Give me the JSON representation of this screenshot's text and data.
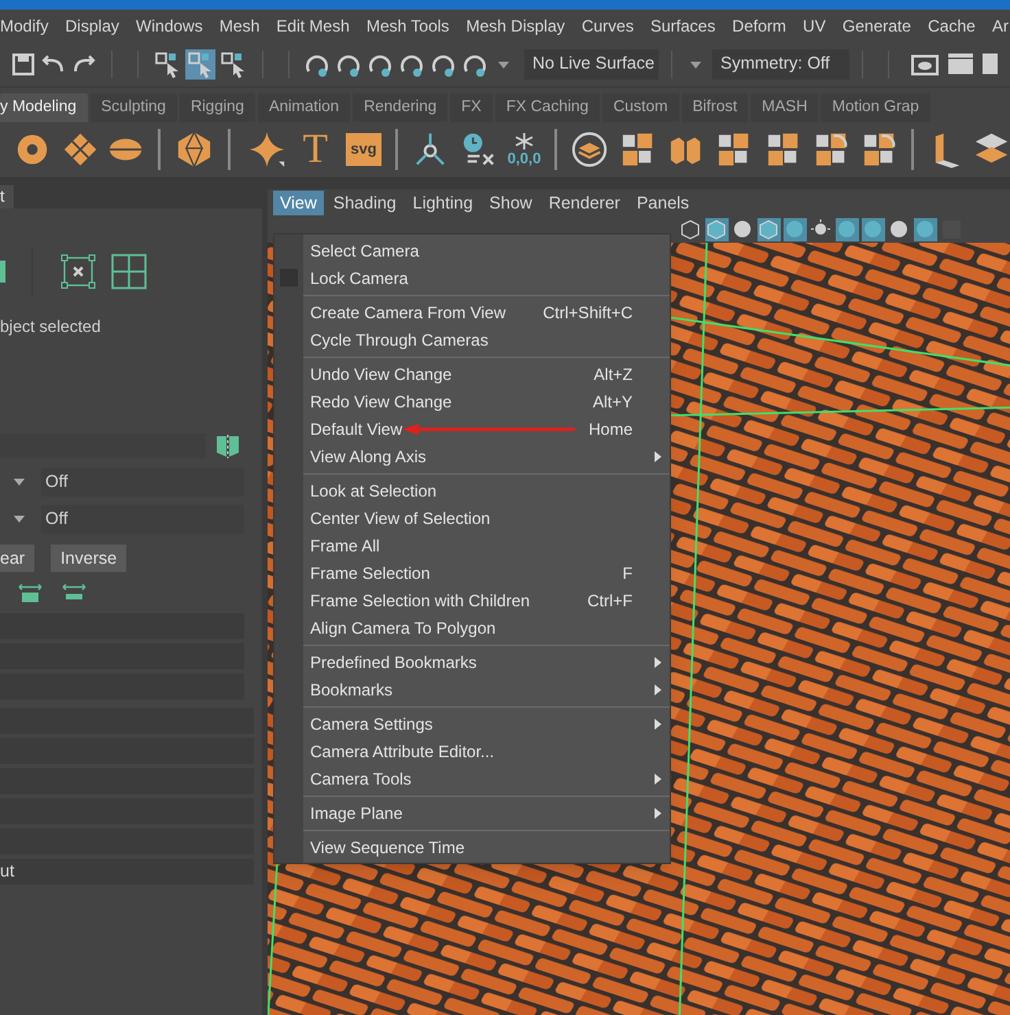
{
  "menu_bar": [
    "Modify",
    "Display",
    "Windows",
    "Mesh",
    "Edit Mesh",
    "Mesh Tools",
    "Mesh Display",
    "Curves",
    "Surfaces",
    "Deform",
    "UV",
    "Generate",
    "Cache",
    "Ar"
  ],
  "status_line": {
    "live_surface": "No Live Surface",
    "symmetry": "Symmetry: Off"
  },
  "shelf_tabs": [
    {
      "label": "y Modeling",
      "selected": true
    },
    {
      "label": "Sculpting",
      "selected": false
    },
    {
      "label": "Rigging",
      "selected": false
    },
    {
      "label": "Animation",
      "selected": false
    },
    {
      "label": "Rendering",
      "selected": false
    },
    {
      "label": "FX",
      "selected": false
    },
    {
      "label": "FX Caching",
      "selected": false
    },
    {
      "label": "Custom",
      "selected": false
    },
    {
      "label": "Bifrost",
      "selected": false
    },
    {
      "label": "MASH",
      "selected": false
    },
    {
      "label": "Motion Grap",
      "selected": false
    }
  ],
  "shelf_icon_texts": {
    "text_tool": "T",
    "svg_tool": "svg",
    "freeze": "0,0,0"
  },
  "side_panel": {
    "tab": "t",
    "selection_message": "bject selected",
    "dropdowns": [
      "Off",
      "Off"
    ],
    "buttons": [
      "ear",
      "Inverse"
    ],
    "last_row": "ut"
  },
  "viewport": {
    "menu": [
      {
        "label": "View",
        "selected": true
      },
      {
        "label": "Shading",
        "selected": false
      },
      {
        "label": "Lighting",
        "selected": false
      },
      {
        "label": "Show",
        "selected": false
      },
      {
        "label": "Renderer",
        "selected": false
      },
      {
        "label": "Panels",
        "selected": false
      }
    ]
  },
  "view_menu": {
    "sections": [
      [
        {
          "label": "Select Camera",
          "submenu": false,
          "kind": "command",
          "marked": false
        },
        {
          "label": "Lock Camera",
          "submenu": false,
          "kind": "checkbox",
          "checked": false,
          "marked": false
        }
      ],
      [
        {
          "label": "Create Camera From View",
          "shortcut": "Ctrl+Shift+C",
          "submenu": false,
          "kind": "command",
          "marked": false
        },
        {
          "label": "Cycle Through Cameras",
          "submenu": false,
          "kind": "command",
          "marked": false
        }
      ],
      [
        {
          "label": "Undo View Change",
          "shortcut": "Alt+Z",
          "submenu": false,
          "kind": "command",
          "marked": false
        },
        {
          "label": "Redo View Change",
          "shortcut": "Alt+Y",
          "submenu": false,
          "kind": "command",
          "marked": false
        },
        {
          "label": "Default View",
          "shortcut": "Home",
          "submenu": false,
          "kind": "command",
          "marked": true
        },
        {
          "label": "View Along Axis",
          "submenu": true,
          "kind": "command",
          "marked": false
        }
      ],
      [
        {
          "label": "Look at Selection",
          "submenu": false,
          "kind": "command",
          "marked": false
        },
        {
          "label": "Center View of Selection",
          "submenu": false,
          "kind": "command",
          "marked": false
        },
        {
          "label": "Frame All",
          "submenu": false,
          "kind": "command",
          "marked": false
        },
        {
          "label": "Frame Selection",
          "shortcut": "F",
          "submenu": false,
          "kind": "command",
          "marked": false
        },
        {
          "label": "Frame Selection with Children",
          "shortcut": "Ctrl+F",
          "submenu": false,
          "kind": "command",
          "marked": false
        },
        {
          "label": "Align Camera To Polygon",
          "submenu": false,
          "kind": "command",
          "marked": false
        }
      ],
      [
        {
          "label": "Predefined Bookmarks",
          "submenu": true,
          "kind": "command",
          "marked": false
        },
        {
          "label": "Bookmarks",
          "submenu": true,
          "kind": "command",
          "marked": false
        }
      ],
      [
        {
          "label": "Camera Settings",
          "submenu": true,
          "kind": "command",
          "marked": false
        },
        {
          "label": "Camera Attribute Editor...",
          "submenu": false,
          "kind": "command",
          "marked": false
        },
        {
          "label": "Camera Tools",
          "submenu": true,
          "kind": "command",
          "marked": false
        }
      ],
      [
        {
          "label": "Image Plane",
          "submenu": true,
          "kind": "command",
          "marked": false
        }
      ],
      [
        {
          "label": "View Sequence Time",
          "submenu": false,
          "kind": "command",
          "marked": false
        }
      ]
    ]
  }
}
